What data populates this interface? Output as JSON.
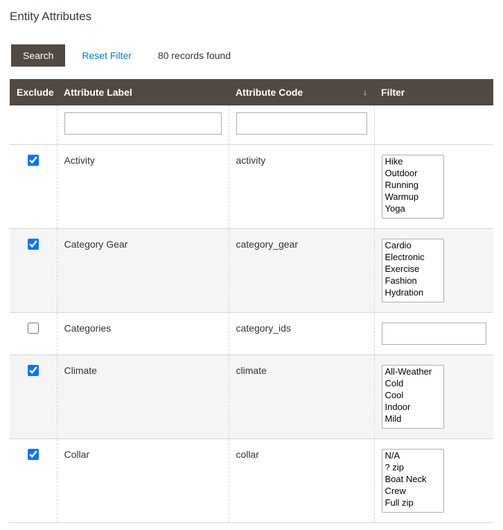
{
  "page": {
    "title": "Entity Attributes"
  },
  "toolbar": {
    "search_label": "Search",
    "reset_label": "Reset Filter",
    "records_found": "80 records found"
  },
  "columns": {
    "exclude": "Exclude",
    "attribute_label": "Attribute Label",
    "attribute_code": "Attribute Code",
    "filter": "Filter"
  },
  "rows": [
    {
      "excluded": true,
      "label": "Activity",
      "code": "activity",
      "filter_type": "multiselect",
      "options": [
        "Hike",
        "Outdoor",
        "Running",
        "Warmup",
        "Yoga"
      ]
    },
    {
      "excluded": true,
      "label": "Category Gear",
      "code": "category_gear",
      "filter_type": "multiselect",
      "options": [
        "Cardio",
        "Electronic",
        "Exercise",
        "Fashion",
        "Hydration"
      ]
    },
    {
      "excluded": false,
      "label": "Categories",
      "code": "category_ids",
      "filter_type": "text",
      "value": ""
    },
    {
      "excluded": true,
      "label": "Climate",
      "code": "climate",
      "filter_type": "multiselect",
      "options": [
        "All-Weather",
        "Cold",
        "Cool",
        "Indoor",
        "Mild"
      ]
    },
    {
      "excluded": true,
      "label": "Collar",
      "code": "collar",
      "filter_type": "multiselect",
      "options": [
        "N/A",
        "? zip",
        "Boat Neck",
        "Crew",
        "Full zip"
      ]
    }
  ]
}
